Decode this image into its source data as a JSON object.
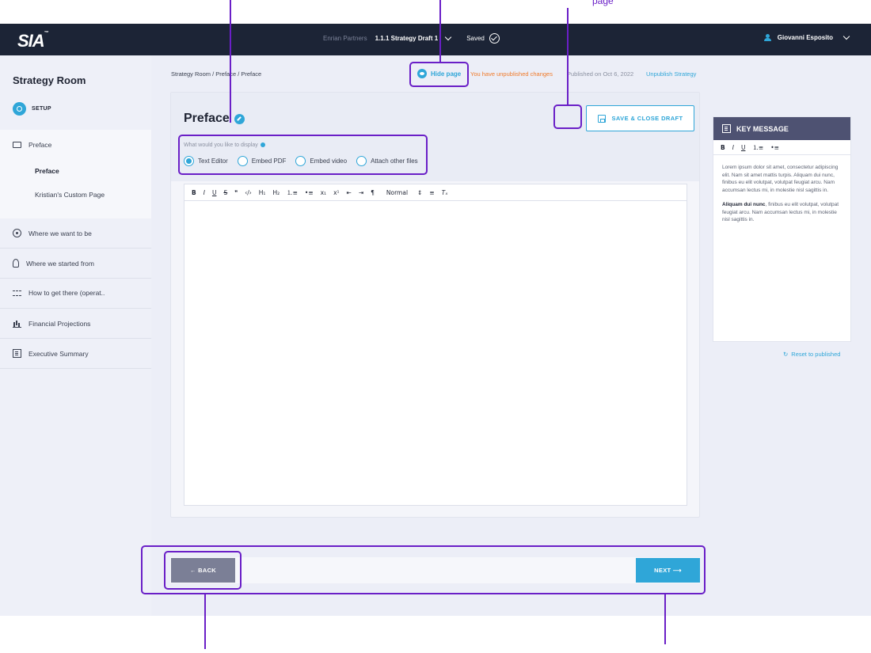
{
  "topbar": {
    "logo": "SIA",
    "logo_mark": "™",
    "partner": "Enrian Partners",
    "draft": "1.1.1 Strategy Draft 1",
    "saved": "Saved",
    "user": "Giovanni Esposito"
  },
  "sidebar": {
    "title": "Strategy Room",
    "setup": "SETUP",
    "items": [
      {
        "label": "Preface",
        "icon": "monitor-icon"
      },
      {
        "label": "Where we want to be",
        "icon": "target-icon"
      },
      {
        "label": "Where we started from",
        "icon": "rocket-icon"
      },
      {
        "label": "How to get there (operat..",
        "icon": "path-icon"
      },
      {
        "label": "Financial Projections",
        "icon": "bar-chart-icon"
      },
      {
        "label": "Executive Summary",
        "icon": "report-icon"
      }
    ],
    "subitems": [
      {
        "label": "Preface",
        "active": true
      },
      {
        "label": "Kristian's Custom Page",
        "active": false
      }
    ]
  },
  "header": {
    "breadcrumb": "Strategy Room  /  Preface  /  Preface",
    "hide_page": "Hide page",
    "unpublished": "You have unpublished changes",
    "published_on": "Published on Oct 6, 2022",
    "unpublish": "Unpublish Strategy"
  },
  "editor": {
    "title": "Preface",
    "display_label": "What would you like to display",
    "options": [
      "Text Editor",
      "Embed PDF",
      "Embed video",
      "Attach other files"
    ],
    "selected_option": "Text Editor",
    "save_button": "SAVE & CLOSE DRAFT",
    "toolbar": [
      "B",
      "I",
      "U",
      "S",
      "❞",
      "‹/›",
      "H₁",
      "H₂",
      "⒈≡",
      "•≡",
      "x₁",
      "x¹",
      "⇤",
      "⇥",
      "¶",
      "Normal",
      "⇕",
      "≡",
      "Tₓ"
    ],
    "format_value": "Normal",
    "content": ""
  },
  "key_message": {
    "title": "KEY MESSAGE",
    "toolbar": [
      "B",
      "I",
      "U",
      "⒈≡",
      "•≡"
    ],
    "paragraph1": "Lorem ipsum dolor sit amet, consectetur adipiscing elit. Nam sit amet mattis turpis. Aliquam dui nunc, finibus eu elit volutpat, volutpat feugiat arcu. Nam accumsan lectus mi, in molestie nisl sagittis in.",
    "paragraph2_bold": "Aliquam dui nunc",
    "paragraph2_rest": ", finibus eu elit volutpat, volutpat feugiat arcu. Nam accumsan lectus mi, in molestie nisl sagittis in.",
    "reset": "Reset to published"
  },
  "footer": {
    "back": "← BACK",
    "next": "NEXT ⟶"
  },
  "annotation": {
    "clipped_text": "page"
  },
  "colors": {
    "accent": "#2fa6d8",
    "nav_bg": "#1c2436",
    "warning": "#f07a2a",
    "highlight": "#6a1fc7",
    "back_button": "#7b7f96"
  }
}
